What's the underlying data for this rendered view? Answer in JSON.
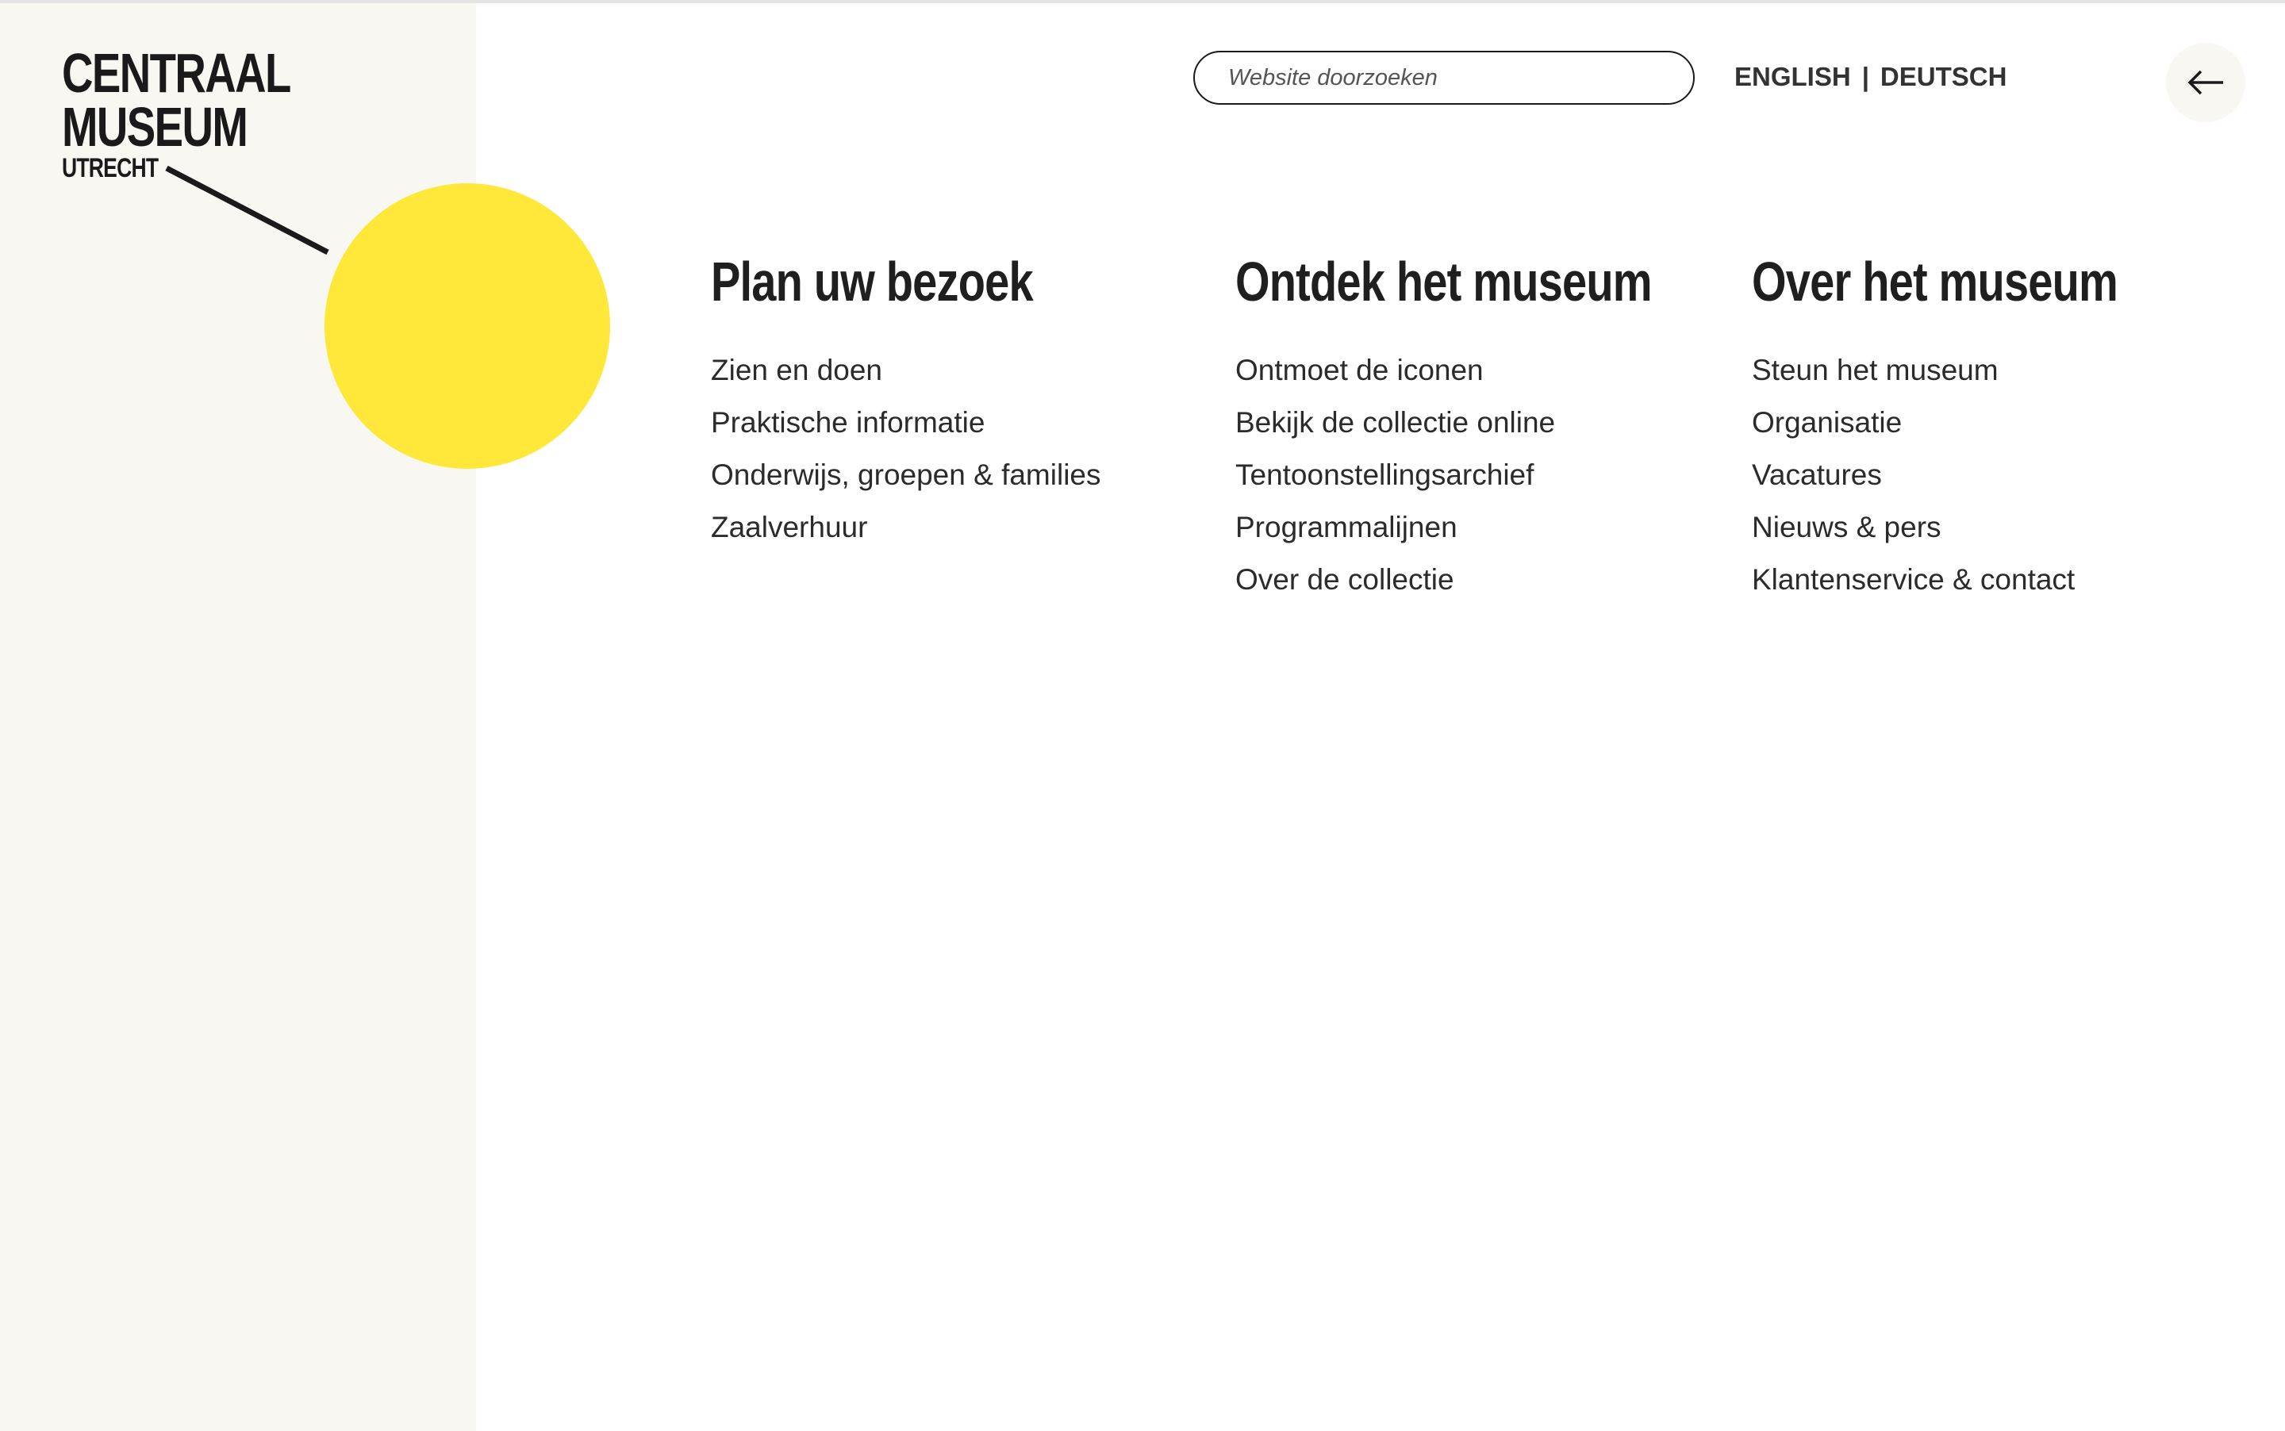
{
  "logo": {
    "line1": "CENTRAAL",
    "line2": "MUSEUM",
    "line3": "UTRECHT"
  },
  "colors": {
    "sidebar_bg": "#f9f7f1",
    "accent_yellow": "#ffe83a",
    "text_dark": "#222222"
  },
  "search": {
    "placeholder": "Website doorzoeken"
  },
  "languages": {
    "english": "ENGLISH",
    "separator": "|",
    "deutsch": "DEUTSCH"
  },
  "back_button": {
    "icon": "arrow-left-icon"
  },
  "nav": [
    {
      "heading": "Plan uw bezoek",
      "items": [
        "Zien en doen",
        "Praktische informatie",
        "Onderwijs, groepen & families",
        "Zaalverhuur"
      ]
    },
    {
      "heading": "Ontdek het museum",
      "items": [
        "Ontmoet de iconen",
        "Bekijk de collectie online",
        "Tentoonstellingsarchief",
        "Programmalijnen",
        "Over de collectie"
      ]
    },
    {
      "heading": "Over het museum",
      "items": [
        "Steun het museum",
        "Organisatie",
        "Vacatures",
        "Nieuws & pers",
        "Klantenservice & contact"
      ]
    }
  ]
}
